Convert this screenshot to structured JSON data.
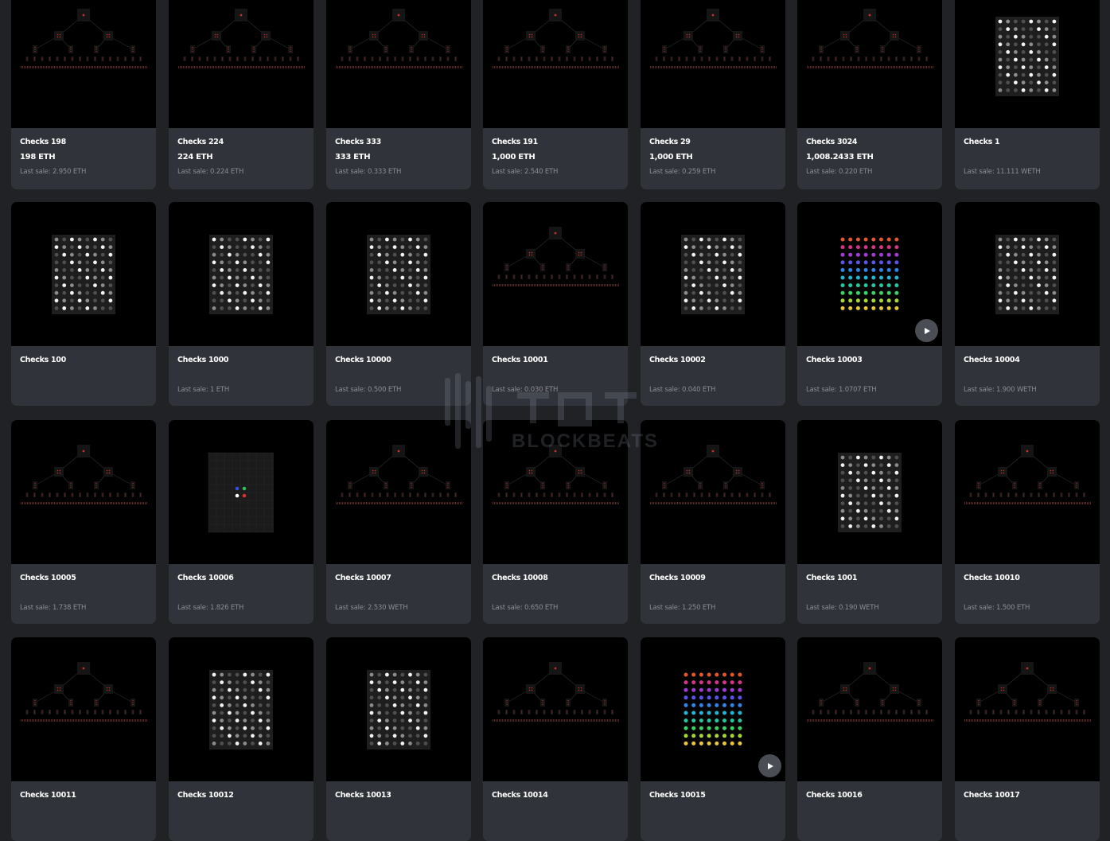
{
  "watermark": {
    "brand": "BLOCKBEATS"
  },
  "colors": {
    "page_bg": "#202226",
    "card_bg": "#303339",
    "art_bg": "#000000",
    "secondary_text": "#8a8d93",
    "tree_red": "#c3322a"
  },
  "cards": [
    {
      "name": "Checks 198",
      "price": "198 ETH",
      "last_sale": "Last sale: 2.950 ETH",
      "art": "tree",
      "play": false
    },
    {
      "name": "Checks 224",
      "price": "224 ETH",
      "last_sale": "Last sale: 0.224 ETH",
      "art": "tree",
      "play": false
    },
    {
      "name": "Checks 333",
      "price": "333 ETH",
      "last_sale": "Last sale: 0.333 ETH",
      "art": "tree",
      "play": false
    },
    {
      "name": "Checks 191",
      "price": "1,000 ETH",
      "last_sale": "Last sale: 2.540 ETH",
      "art": "tree",
      "play": false
    },
    {
      "name": "Checks 29",
      "price": "1,000 ETH",
      "last_sale": "Last sale: 0.259 ETH",
      "art": "tree",
      "play": false
    },
    {
      "name": "Checks 3024",
      "price": "1,008.2433 ETH",
      "last_sale": "Last sale: 0.220 ETH",
      "art": "tree",
      "play": false
    },
    {
      "name": "Checks 1",
      "price": "",
      "last_sale": "Last sale: 11.111 WETH",
      "art": "grid",
      "play": false
    },
    {
      "name": "Checks 100",
      "price": "",
      "last_sale": "",
      "art": "grid",
      "play": false
    },
    {
      "name": "Checks 1000",
      "price": "",
      "last_sale": "Last sale: 1 ETH",
      "art": "grid",
      "play": false
    },
    {
      "name": "Checks 10000",
      "price": "",
      "last_sale": "Last sale: 0.500 ETH",
      "art": "grid",
      "play": false
    },
    {
      "name": "Checks 10001",
      "price": "",
      "last_sale": "Last sale: 0.030 ETH",
      "art": "tree",
      "play": false
    },
    {
      "name": "Checks 10002",
      "price": "",
      "last_sale": "Last sale: 0.040 ETH",
      "art": "grid",
      "play": false
    },
    {
      "name": "Checks 10003",
      "price": "",
      "last_sale": "Last sale: 1.0707 ETH",
      "art": "rainbow",
      "play": true
    },
    {
      "name": "Checks 10004",
      "price": "",
      "last_sale": "Last sale: 1.900 WETH",
      "art": "grid",
      "play": false
    },
    {
      "name": "Checks 10005",
      "price": "",
      "last_sale": "Last sale: 1.738 ETH",
      "art": "tree",
      "play": false
    },
    {
      "name": "Checks 10006",
      "price": "",
      "last_sale": "Last sale: 1.826 ETH",
      "art": "four",
      "play": false
    },
    {
      "name": "Checks 10007",
      "price": "",
      "last_sale": "Last sale: 2.530 WETH",
      "art": "tree",
      "play": false
    },
    {
      "name": "Checks 10008",
      "price": "",
      "last_sale": "Last sale: 0.650 ETH",
      "art": "tree",
      "play": false
    },
    {
      "name": "Checks 10009",
      "price": "",
      "last_sale": "Last sale: 1.250 ETH",
      "art": "tree",
      "play": false
    },
    {
      "name": "Checks 1001",
      "price": "",
      "last_sale": "Last sale: 0.190 WETH",
      "art": "grid",
      "play": false
    },
    {
      "name": "Checks 10010",
      "price": "",
      "last_sale": "Last sale: 1.500 ETH",
      "art": "tree",
      "play": false
    },
    {
      "name": "Checks 10011",
      "price": "",
      "last_sale": "",
      "art": "tree",
      "play": false
    },
    {
      "name": "Checks 10012",
      "price": "",
      "last_sale": "",
      "art": "grid",
      "play": false
    },
    {
      "name": "Checks 10013",
      "price": "",
      "last_sale": "",
      "art": "grid",
      "play": false
    },
    {
      "name": "Checks 10014",
      "price": "",
      "last_sale": "",
      "art": "tree",
      "play": false
    },
    {
      "name": "Checks 10015",
      "price": "",
      "last_sale": "",
      "art": "rainbow",
      "play": true
    },
    {
      "name": "Checks 10016",
      "price": "",
      "last_sale": "",
      "art": "tree",
      "play": false
    },
    {
      "name": "Checks 10017",
      "price": "",
      "last_sale": "",
      "art": "tree",
      "play": false
    }
  ]
}
